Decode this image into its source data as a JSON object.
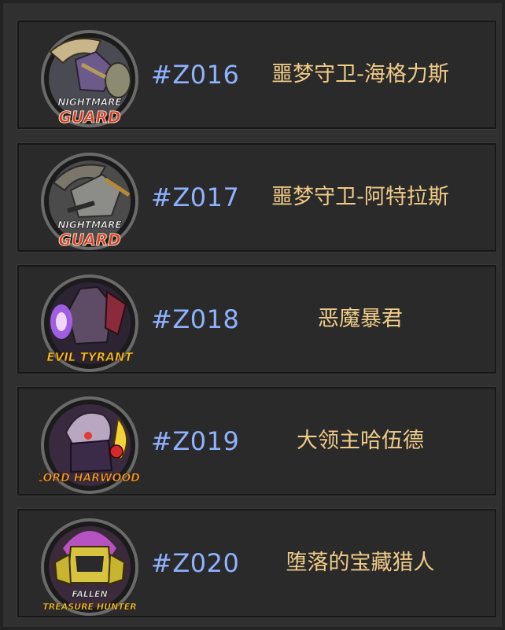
{
  "entries": [
    {
      "code": "#Z016",
      "name": "噩梦守卫-海格力斯",
      "emblem_lines": [
        "NIGHTMARE",
        "GUARD"
      ],
      "emblem_icon": "nightmare-guard-hercules-icon"
    },
    {
      "code": "#Z017",
      "name": "噩梦守卫-阿特拉斯",
      "emblem_lines": [
        "NIGHTMARE",
        "GUARD"
      ],
      "emblem_icon": "nightmare-guard-atlas-icon"
    },
    {
      "code": "#Z018",
      "name": "恶魔暴君",
      "emblem_lines": [
        "EVIL TYRANT"
      ],
      "emblem_icon": "evil-tyrant-icon"
    },
    {
      "code": "#Z019",
      "name": "大领主哈伍德",
      "emblem_lines": [
        "LORD HARWOOD"
      ],
      "emblem_icon": "lord-harwood-icon"
    },
    {
      "code": "#Z020",
      "name": "堕落的宝藏猎人",
      "emblem_lines": [
        "FALLEN",
        "TREASURE HUNTER"
      ],
      "emblem_icon": "fallen-treasure-hunter-icon"
    }
  ],
  "colors": {
    "code": "#8fb2ff",
    "name": "#f0cc88",
    "panel_bg": "#2a2a2a",
    "page_bg": "#303030"
  }
}
